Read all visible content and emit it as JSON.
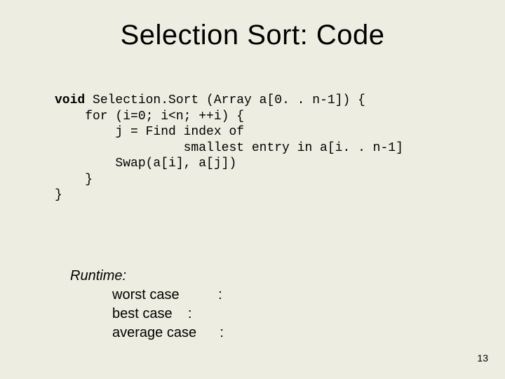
{
  "title": "Selection Sort: Code",
  "code": {
    "kw_void": "void",
    "sig_rest": " Selection.Sort (Array a[0. . n-1]) {",
    "l2": "    for (i=0; i<n; ++i) {",
    "l3": "        j = Find index of",
    "l4": "                 smallest entry in a[i. . n-1]",
    "l5": "        Swap(a[i], a[j])",
    "l6": "    }",
    "l7": "}"
  },
  "runtime": {
    "header": "Runtime:",
    "worst_label": "worst case",
    "worst_sep": ":",
    "best_label": "best case",
    "best_sep": ":",
    "avg_label": "average case",
    "avg_sep": ":"
  },
  "page_number": "13"
}
